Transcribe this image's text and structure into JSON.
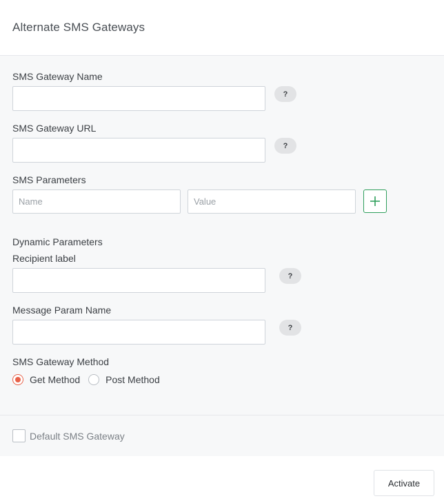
{
  "modal": {
    "title": "Alternate SMS Gateways"
  },
  "form": {
    "gateway_name": {
      "label": "SMS Gateway Name",
      "value": "",
      "help": "?"
    },
    "gateway_url": {
      "label": "SMS Gateway URL",
      "value": "",
      "help": "?"
    },
    "sms_parameters": {
      "label": "SMS Parameters",
      "name_placeholder": "Name",
      "value_placeholder": "Value",
      "add_icon": "plus-icon"
    },
    "dynamic_parameters": {
      "heading": "Dynamic Parameters",
      "recipient_label": {
        "label": "Recipient label",
        "value": "",
        "help": "?"
      },
      "message_param_name": {
        "label": "Message Param Name",
        "value": "",
        "help": "?"
      }
    },
    "method": {
      "label": "SMS Gateway Method",
      "options": [
        {
          "label": "Get Method",
          "checked": true
        },
        {
          "label": "Post Method",
          "checked": false
        }
      ]
    },
    "default_gateway": {
      "label": "Default SMS Gateway",
      "checked": false
    }
  },
  "footer": {
    "activate_label": "Activate"
  },
  "colors": {
    "accent_radio": "#e8624a",
    "add_button": "#2e9e5b"
  }
}
